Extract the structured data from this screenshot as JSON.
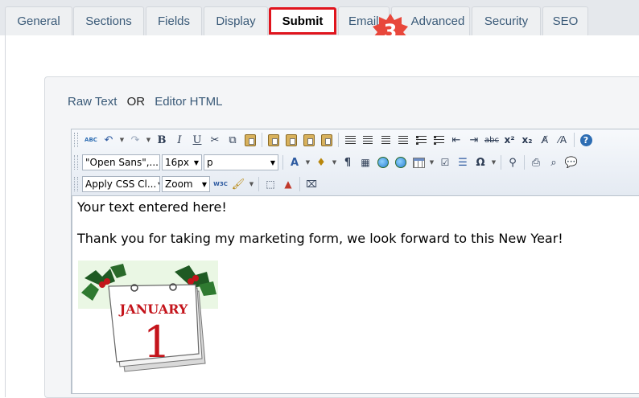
{
  "tabs": [
    {
      "label": "General",
      "active": false
    },
    {
      "label": "Sections",
      "active": false
    },
    {
      "label": "Fields",
      "active": false
    },
    {
      "label": "Display",
      "active": false
    },
    {
      "label": "Submit",
      "active": true
    },
    {
      "label": "Emails",
      "active": false
    },
    {
      "label": "Advanced",
      "active": false
    },
    {
      "label": "Security",
      "active": false
    },
    {
      "label": "SEO",
      "active": false
    }
  ],
  "step_badge": {
    "number": "3",
    "color": "#e8473b"
  },
  "highlight_color": "#e0141d",
  "mode_switch": {
    "raw_text": "Raw Text",
    "or": "OR",
    "editor_html": "Editor HTML"
  },
  "toolbar": {
    "row1_icons": [
      "spellcheck-icon",
      "undo-icon",
      "redo-icon",
      "bold-icon",
      "italic-icon",
      "underline-icon",
      "cut-icon",
      "copy-icon",
      "paste-icon",
      "paste-text-icon",
      "paste-word-icon",
      "paste-html-icon",
      "paste-plain-icon",
      "align-justify-icon",
      "align-left-icon",
      "align-center-icon",
      "align-right-icon",
      "bullet-list-icon",
      "numbered-list-icon",
      "outdent-icon",
      "indent-icon",
      "strikethrough-icon",
      "superscript-icon",
      "subscript-icon",
      "format-stripper-icon",
      "clear-format-icon",
      "help-icon"
    ],
    "labels": {
      "bold": "B",
      "italic": "I",
      "underline": "U",
      "strike": "abc",
      "sup": "x²",
      "sub": "x₂",
      "help": "?",
      "abc": "ABC",
      "w3c": "W3C"
    },
    "font_name": "\"Open Sans\",...",
    "font_size": "16px",
    "paragraph": "p",
    "css_class": "Apply CSS Cl...",
    "zoom": "Zoom"
  },
  "editor": {
    "line1": "Your text entered here!",
    "line2": "Thank you for taking my marketing form, we look forward to this New Year!",
    "image": {
      "month": "JANUARY",
      "day": "1"
    }
  }
}
